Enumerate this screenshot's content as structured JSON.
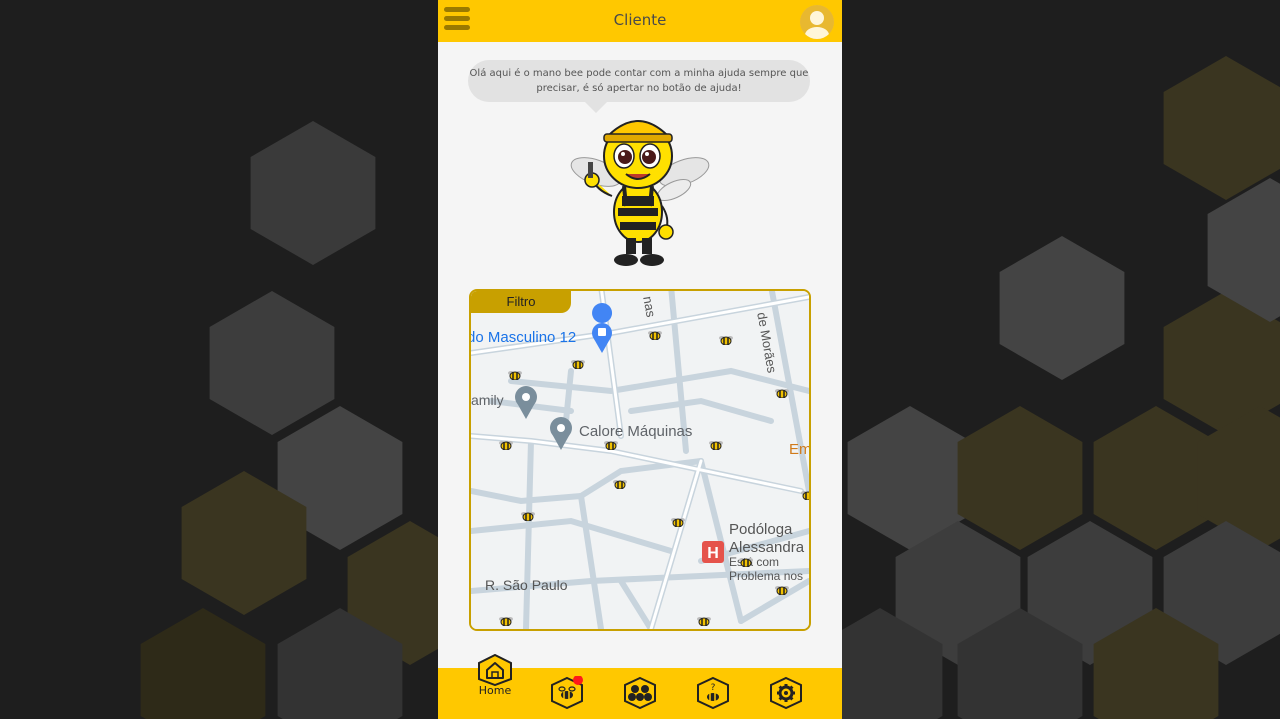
{
  "header": {
    "title": "Cliente",
    "menu_icon": "hamburger-menu-icon",
    "avatar_icon": "user-avatar-icon"
  },
  "assistant": {
    "message": "Olá aqui é o mano bee pode contar com a minha ajuda sempre que precisar, é só apertar no botão de ajuda!"
  },
  "map": {
    "filter_label": "Filtro",
    "places": {
      "p1": "do Masculino 12",
      "p2": "amily",
      "p3": "Calore Máquinas",
      "p4": "Em",
      "p5": "Podóloga",
      "p6": "Alessandra",
      "p7": "Está com",
      "p8": "Problema nos",
      "street1": "R. São Paulo",
      "street2": "de Morães",
      "street3": "nas"
    }
  },
  "bottom_nav": {
    "home_label": "Home",
    "items": [
      "home-icon",
      "bee-map-icon",
      "honeycomb-icon",
      "help-bee-icon",
      "settings-gear-icon"
    ]
  },
  "colors": {
    "brand_yellow": "#ffc800",
    "dark_gold": "#c8a000",
    "background": "#1e1e1e",
    "notification": "#ff1a1a"
  }
}
